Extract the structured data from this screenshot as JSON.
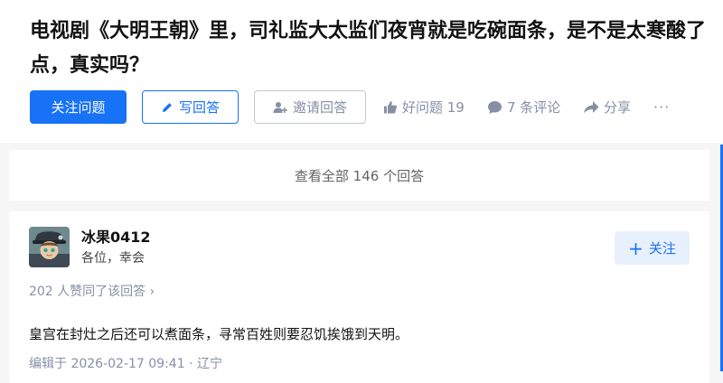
{
  "question": {
    "title": "电视剧《大明王朝》里，司礼监大太监们夜宵就是吃碗面条，是不是太寒酸了点，真实吗？"
  },
  "actions": {
    "follow_label": "关注问题",
    "write_label": "写回答",
    "invite_label": "邀请回答",
    "good_question_label": "好问题 19",
    "comments_label": "7 条评论",
    "share_label": "分享",
    "more_label": "···"
  },
  "view_all": {
    "label": "查看全部 146 个回答"
  },
  "answer": {
    "author_name": "冰果0412",
    "author_bio": "各位，幸会",
    "follow_label": "关注",
    "vote_summary": "202 人赞同了该回答 ›",
    "content": "皇宫在封灶之后还可以煮面条，寻常百姓则要忍饥挨饿到天明。",
    "edit_info": "编辑于 2026-02-17 09:41 · 辽宁"
  },
  "colors": {
    "accent": "#1772f6",
    "muted": "#8590a6",
    "background": "#f6f6f6"
  },
  "icons": [
    "pencil-icon",
    "person-add-icon",
    "thumbs-up-icon",
    "comment-icon",
    "share-icon",
    "plus-icon"
  ]
}
